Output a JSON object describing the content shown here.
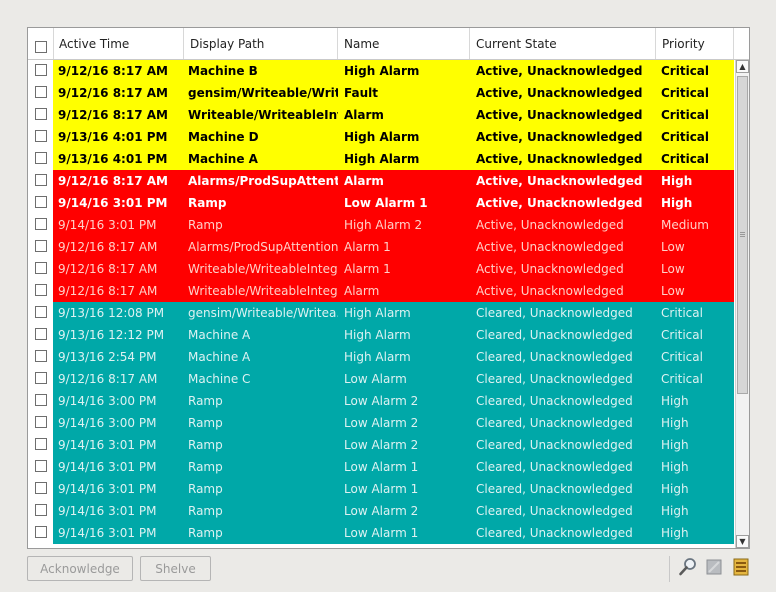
{
  "colors": {
    "critical": "#ffff00",
    "high_active": "#ff0000",
    "cleared": "#00a8a8",
    "text_yellow": "#000000",
    "text_red_bold": "#ffffff",
    "text_red_dim": "#ffd0c8",
    "text_cleared": "#dcf2f2"
  },
  "columns": [
    "Active Time",
    "Display Path",
    "Name",
    "Current State",
    "Priority"
  ],
  "rows": [
    {
      "time": "9/12/16 8:17 AM",
      "path": "Machine B",
      "name": "High Alarm",
      "state": "Active, Unacknowledged",
      "priority": "Critical",
      "style": "yellow"
    },
    {
      "time": "9/12/16 8:17 AM",
      "path": "gensim/Writeable/Writea...",
      "name": "Fault",
      "state": "Active, Unacknowledged",
      "priority": "Critical",
      "style": "yellow"
    },
    {
      "time": "9/12/16 8:17 AM",
      "path": "Writeable/WriteableInte...",
      "name": "Alarm",
      "state": "Active, Unacknowledged",
      "priority": "Critical",
      "style": "yellow"
    },
    {
      "time": "9/13/16 4:01 PM",
      "path": "Machine D",
      "name": "High Alarm",
      "state": "Active, Unacknowledged",
      "priority": "Critical",
      "style": "yellow"
    },
    {
      "time": "9/13/16 4:01 PM",
      "path": "Machine A",
      "name": "High Alarm",
      "state": "Active, Unacknowledged",
      "priority": "Critical",
      "style": "yellow"
    },
    {
      "time": "9/12/16 8:17 AM",
      "path": "Alarms/ProdSupAttentio...",
      "name": "Alarm",
      "state": "Active, Unacknowledged",
      "priority": "High",
      "style": "red-bold"
    },
    {
      "time": "9/14/16 3:01 PM",
      "path": "Ramp",
      "name": "Low Alarm 1",
      "state": "Active, Unacknowledged",
      "priority": "High",
      "style": "red-bold"
    },
    {
      "time": "9/14/16 3:01 PM",
      "path": "Ramp",
      "name": "High Alarm 2",
      "state": "Active, Unacknowledged",
      "priority": "Medium",
      "style": "red"
    },
    {
      "time": "9/12/16 8:17 AM",
      "path": "Alarms/ProdSupAttention/...",
      "name": "Alarm 1",
      "state": "Active, Unacknowledged",
      "priority": "Low",
      "style": "red"
    },
    {
      "time": "9/12/16 8:17 AM",
      "path": "Writeable/WriteableInteg...",
      "name": "Alarm 1",
      "state": "Active, Unacknowledged",
      "priority": "Low",
      "style": "red"
    },
    {
      "time": "9/12/16 8:17 AM",
      "path": "Writeable/WriteableInteg...",
      "name": "Alarm",
      "state": "Active, Unacknowledged",
      "priority": "Low",
      "style": "red"
    },
    {
      "time": "9/13/16 12:08 PM",
      "path": "gensim/Writeable/Writea...",
      "name": "High Alarm",
      "state": "Cleared, Unacknowledged",
      "priority": "Critical",
      "style": "teal"
    },
    {
      "time": "9/13/16 12:12 PM",
      "path": "Machine A",
      "name": "High Alarm",
      "state": "Cleared, Unacknowledged",
      "priority": "Critical",
      "style": "teal"
    },
    {
      "time": "9/13/16 2:54 PM",
      "path": "Machine A",
      "name": "High Alarm",
      "state": "Cleared, Unacknowledged",
      "priority": "Critical",
      "style": "teal"
    },
    {
      "time": "9/12/16 8:17 AM",
      "path": "Machine C",
      "name": "Low Alarm",
      "state": "Cleared, Unacknowledged",
      "priority": "Critical",
      "style": "teal"
    },
    {
      "time": "9/14/16 3:00 PM",
      "path": "Ramp",
      "name": "Low Alarm 2",
      "state": "Cleared, Unacknowledged",
      "priority": "High",
      "style": "teal"
    },
    {
      "time": "9/14/16 3:00 PM",
      "path": "Ramp",
      "name": "Low Alarm 2",
      "state": "Cleared, Unacknowledged",
      "priority": "High",
      "style": "teal"
    },
    {
      "time": "9/14/16 3:01 PM",
      "path": "Ramp",
      "name": "Low Alarm 2",
      "state": "Cleared, Unacknowledged",
      "priority": "High",
      "style": "teal"
    },
    {
      "time": "9/14/16 3:01 PM",
      "path": "Ramp",
      "name": "Low Alarm 1",
      "state": "Cleared, Unacknowledged",
      "priority": "High",
      "style": "teal"
    },
    {
      "time": "9/14/16 3:01 PM",
      "path": "Ramp",
      "name": "Low Alarm 1",
      "state": "Cleared, Unacknowledged",
      "priority": "High",
      "style": "teal"
    },
    {
      "time": "9/14/16 3:01 PM",
      "path": "Ramp",
      "name": "Low Alarm 2",
      "state": "Cleared, Unacknowledged",
      "priority": "High",
      "style": "teal"
    },
    {
      "time": "9/14/16 3:01 PM",
      "path": "Ramp",
      "name": "Low Alarm 1",
      "state": "Cleared, Unacknowledged",
      "priority": "High",
      "style": "teal"
    }
  ],
  "buttons": {
    "acknowledge": "Acknowledge",
    "shelve": "Shelve"
  },
  "tools": [
    "magnifier-icon",
    "filter-panel-icon",
    "export-table-icon"
  ]
}
